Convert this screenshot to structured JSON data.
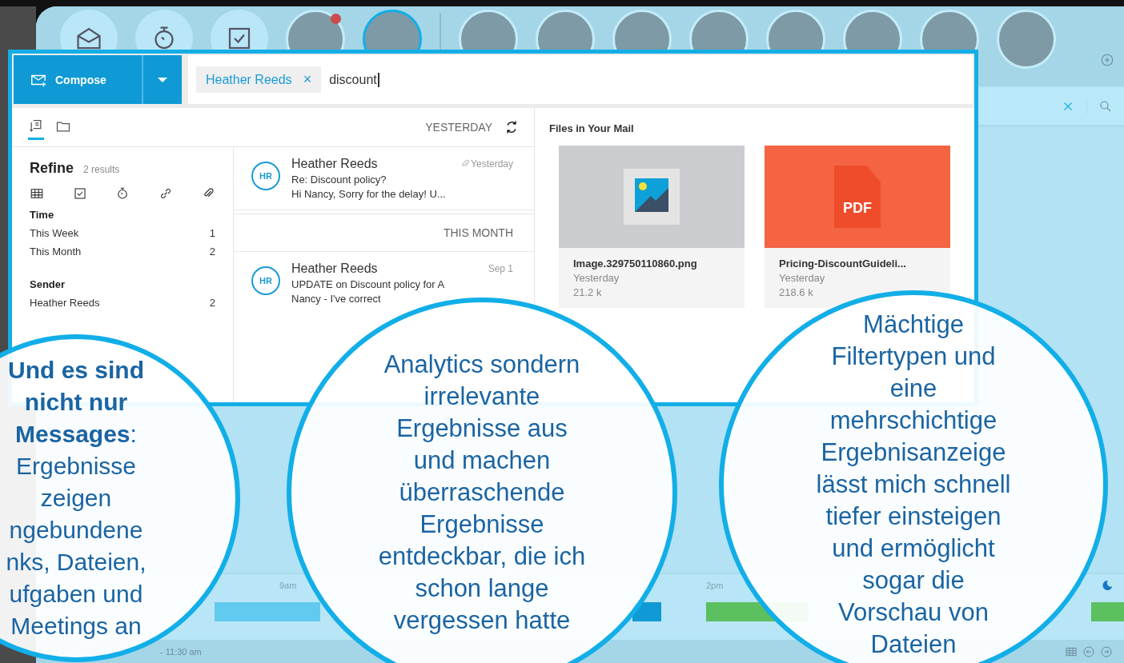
{
  "top_bar": {
    "shortcuts": [
      {
        "kind": "mail"
      },
      {
        "kind": "timer"
      },
      {
        "kind": "tasks"
      }
    ],
    "contacts": [
      {
        "selected": false,
        "unread": true
      },
      {
        "selected": true,
        "unread": false
      },
      {
        "selected": false,
        "unread": false
      },
      {
        "selected": false,
        "unread": false
      },
      {
        "selected": false,
        "unread": false
      },
      {
        "selected": false,
        "unread": false
      },
      {
        "selected": false,
        "unread": false
      },
      {
        "selected": false,
        "unread": false
      },
      {
        "selected": false,
        "unread": false
      },
      {
        "selected": false,
        "unread": false
      }
    ]
  },
  "compose": {
    "label": "Compose"
  },
  "search": {
    "chip": "Heather Reeds",
    "chip_remove": "×",
    "value": "discount"
  },
  "view_tabs": [
    {
      "kind": "list",
      "selected": true
    },
    {
      "kind": "folder",
      "selected": false
    }
  ],
  "refine": {
    "title": "Refine",
    "count": "2 results",
    "filters": [
      {
        "kind": "calendar"
      },
      {
        "kind": "tasks"
      },
      {
        "kind": "timer"
      },
      {
        "kind": "link"
      },
      {
        "kind": "attachment"
      }
    ],
    "groups": [
      {
        "title": "Time",
        "items": [
          {
            "label": "This Week",
            "count": "1"
          },
          {
            "label": "This Month",
            "count": "2"
          }
        ]
      },
      {
        "title": "Sender",
        "items": [
          {
            "label": "Heather Reeds",
            "count": "2"
          }
        ]
      }
    ]
  },
  "messages": {
    "groups": [
      {
        "heading": "YESTERDAY",
        "items": [
          {
            "initials": "HR",
            "sender": "Heather Reeds",
            "date": "Yesterday",
            "attachment": true,
            "subject": "Re: Discount policy?",
            "preview": "Hi Nancy, Sorry for the delay! U..."
          }
        ]
      },
      {
        "heading": "THIS MONTH",
        "items": [
          {
            "initials": "HR",
            "sender": "Heather Reeds",
            "date": "Sep 1",
            "attachment": false,
            "subject": "UPDATE on Discount policy for A",
            "preview": "Nancy - I've correct"
          }
        ]
      }
    ]
  },
  "files": {
    "title": "Files in Your Mail",
    "items": [
      {
        "kind": "image",
        "name": "Image.329750110860.png",
        "date": "Yesterday",
        "size": "21.2 k"
      },
      {
        "kind": "pdf",
        "badge": "PDF",
        "name": "Pricing-DiscountGuideli...",
        "date": "Yesterday",
        "size": "218.6 k"
      }
    ]
  },
  "timeline": {
    "hours": [
      "9am",
      "2pm"
    ],
    "events": [
      {
        "color": "#62c9ef"
      },
      {
        "color": "#0f9ad6"
      },
      {
        "color": "#5cbf60"
      },
      {
        "color": "#5cbf60"
      }
    ],
    "range": "- 11:30 am"
  },
  "callouts": [
    {
      "text": "**Und es sind**\n**nicht nur**\n**Messages**:\nErgebnisse\nzeigen\nngebundene\nnks, Dateien,\nufgaben und\nMeetings an"
    },
    {
      "text": "Analytics sondern\nirrelevante\nErgebnisse aus\nund machen\nüberraschende\nErgebnisse\nentdeckbar, die ich\nschon lange\nvergessen hatte"
    },
    {
      "text": "Mächtige\nFiltertypen und\neine\nmehrschichtige\nErgebnisanzeige\nlässt mich schnell\ntiefer einsteigen\nund ermöglicht\nsogar die\nVorschau von\nDateien"
    }
  ]
}
